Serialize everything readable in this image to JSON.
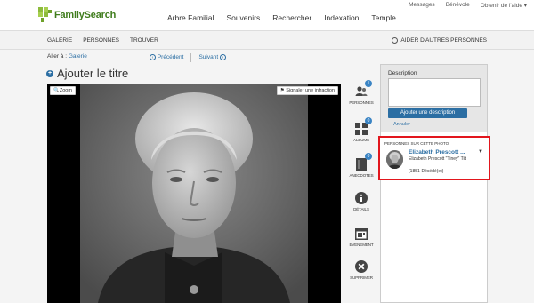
{
  "header": {
    "logo_text": "FamilySearch",
    "top_links": [
      "Messages",
      "Bénévole",
      "Obtenir de l'aide ▾"
    ],
    "nav": [
      "Arbre Familial",
      "Souvenirs",
      "Rechercher",
      "Indexation",
      "Temple"
    ]
  },
  "subnav": {
    "items": [
      "GALERIE",
      "PERSONNES",
      "TROUVER"
    ],
    "help_label": "AIDER D'AUTRES PERSONNES"
  },
  "breadcrumb": {
    "goto_label": "Aller à :",
    "goto_link": "Galerie",
    "prev_label": "Précédent",
    "next_label": "Suivant"
  },
  "title": "Ajouter le titre",
  "photo": {
    "zoom_label": "Zoom",
    "report_label": "Signaler une infraction"
  },
  "tools": [
    {
      "label": "PERSONNES",
      "badge": "1"
    },
    {
      "label": "ALBUMS",
      "badge": "0"
    },
    {
      "label": "ANECDOTES",
      "badge": "0"
    },
    {
      "label": "DÉTAILS"
    },
    {
      "label": "ÉVÉNEMENT"
    },
    {
      "label": "SUPPRIMER"
    }
  ],
  "panel": {
    "description_label": "Description",
    "add_description": "Ajouter une description",
    "cancel": "Annuler",
    "persons_heading": "PERSONNES SUR CETTE PHOTO",
    "person": {
      "name": "Elizabeth Prescott ...",
      "full_name": "Elizabeth Prescott \"Tiney\" Tilt",
      "dates": "(1851-Décédé(e))"
    }
  },
  "colors": {
    "accent_blue": "#2b6ea3",
    "badge_blue": "#3a84c4",
    "highlight_red": "#e2161d",
    "logo_green": "#3f7c1c"
  }
}
